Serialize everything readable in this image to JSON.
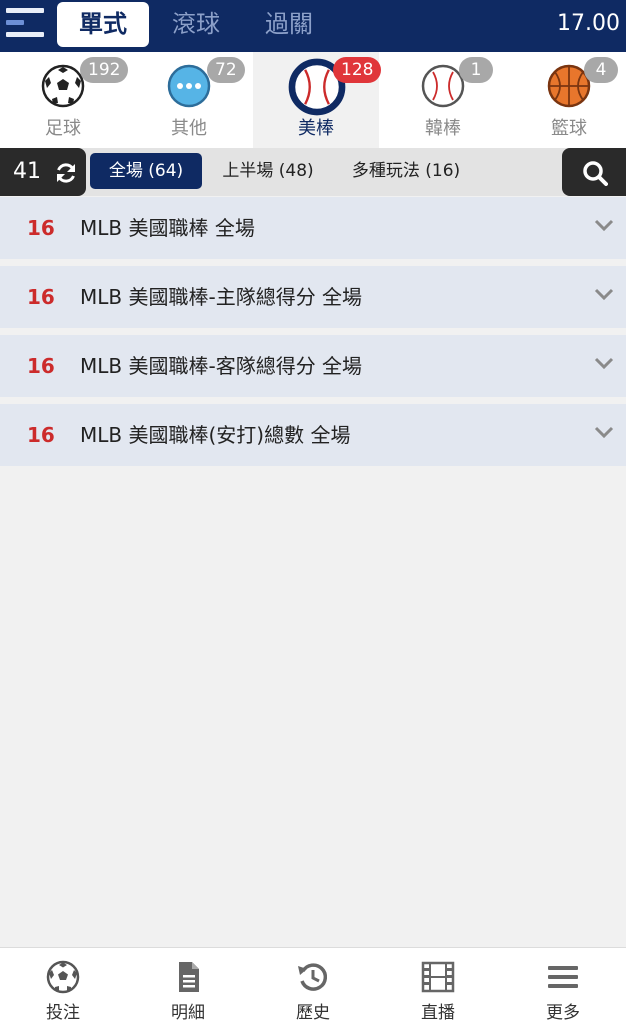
{
  "header": {
    "tabs": [
      {
        "label": "單式",
        "active": true
      },
      {
        "label": "滾球",
        "active": false
      },
      {
        "label": "過關",
        "active": false
      }
    ],
    "balance": "17.00"
  },
  "sports": [
    {
      "label": "足球",
      "count": "192",
      "icon": "soccer-ball-icon"
    },
    {
      "label": "其他",
      "count": "72",
      "icon": "more-dots-icon"
    },
    {
      "label": "美棒",
      "count": "128",
      "icon": "baseball-icon",
      "active": true
    },
    {
      "label": "韓棒",
      "count": "1",
      "icon": "baseball-icon"
    },
    {
      "label": "籃球",
      "count": "4",
      "icon": "basketball-icon"
    }
  ],
  "filter": {
    "count": "41",
    "tabs": [
      {
        "label": "全場 (64)",
        "active": true
      },
      {
        "label": "上半場 (48)",
        "active": false
      },
      {
        "label": "多種玩法 (16)",
        "active": false
      }
    ]
  },
  "leagues": [
    {
      "count": "16",
      "title": "MLB 美國職棒 全場"
    },
    {
      "count": "16",
      "title": "MLB 美國職棒-主隊總得分 全場"
    },
    {
      "count": "16",
      "title": "MLB 美國職棒-客隊總得分 全場"
    },
    {
      "count": "16",
      "title": "MLB 美國職棒(安打)總數 全場"
    }
  ],
  "bottom_nav": [
    {
      "label": "投注",
      "icon": "soccer-ball-icon"
    },
    {
      "label": "明細",
      "icon": "document-icon"
    },
    {
      "label": "歷史",
      "icon": "history-icon"
    },
    {
      "label": "直播",
      "icon": "film-icon"
    },
    {
      "label": "更多",
      "icon": "menu-icon"
    }
  ],
  "colors": {
    "primary": "#0f2a63",
    "accent_red": "#e0363a",
    "list_bg": "#e2e7f0"
  }
}
